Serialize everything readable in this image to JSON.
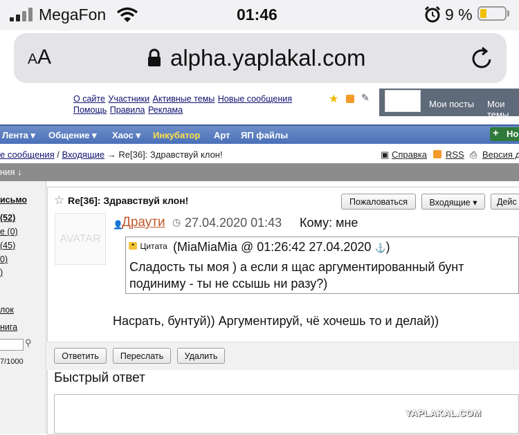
{
  "status_bar": {
    "carrier": "MegaFon",
    "time": "01:46",
    "battery_text": "9 %",
    "battery_level": 0.09
  },
  "browser": {
    "aa_label": "A",
    "aa_label_big": "A",
    "url": "alpha.yaplakal.com"
  },
  "site_header": {
    "links_row1": [
      "О сайте",
      "Участники",
      "Активные темы",
      "Новые сообщения"
    ],
    "links_row2": [
      "Помощь",
      "Правила",
      "Реклама"
    ],
    "my_posts": "Мои посты",
    "my_themes": "Мои темы"
  },
  "nav": {
    "items": [
      "Лента ▾",
      "Общение ▾",
      "Хаос ▾",
      "Инкубатор",
      "Арт",
      "ЯП файлы"
    ],
    "new_button": "Но"
  },
  "breadcrumb": {
    "part1": "е сообщения",
    "sep1": " / ",
    "part2": "Входящие",
    "sep2": " → ",
    "current": "Re[36]: Здравствуй клон!",
    "help": "Справка",
    "rss": "RSS",
    "version": "Версия д"
  },
  "grey_band": {
    "text": "ния ↓"
  },
  "sidebar": {
    "items": [
      "исьмо",
      "(52)",
      "е (0)",
      "(45)",
      "0)",
      ")",
      "лок",
      "нига",
      "7/1000"
    ]
  },
  "message": {
    "title": "Re[36]: Здравствуй клон!",
    "complain_button": "Пожаловаться",
    "inbox_button": "Входящие ▾",
    "delete_partial": "Дейс",
    "avatar_text": "AVATAR",
    "author": "Драути",
    "date": "27.04.2020 01:43",
    "to": "Кому: мне",
    "quote_label": "Цитата",
    "quote_source": "(MiaMiaMia @ 01:26:42 27.04.2020",
    "quote_anchor": "⚓",
    "quote_close": ")",
    "quote_text": "Сладость ты моя ) а если я щас аргументированный бунт подиниму - ты не ссышь ни разу?)",
    "body": "Насрать, бунтуй)) Аргументируй, чё хочешь то и делай))"
  },
  "actions": {
    "reply": "Ответить",
    "forward": "Переслать",
    "delete": "Удалить"
  },
  "quick_reply": {
    "title": "Быстрый ответ"
  },
  "watermark": "YAPLAKAL.COM",
  "colors": {
    "nav_blue": "#5a7fc0",
    "author": "#c2552b",
    "link": "#101070",
    "incubator": "#ffe14a"
  }
}
